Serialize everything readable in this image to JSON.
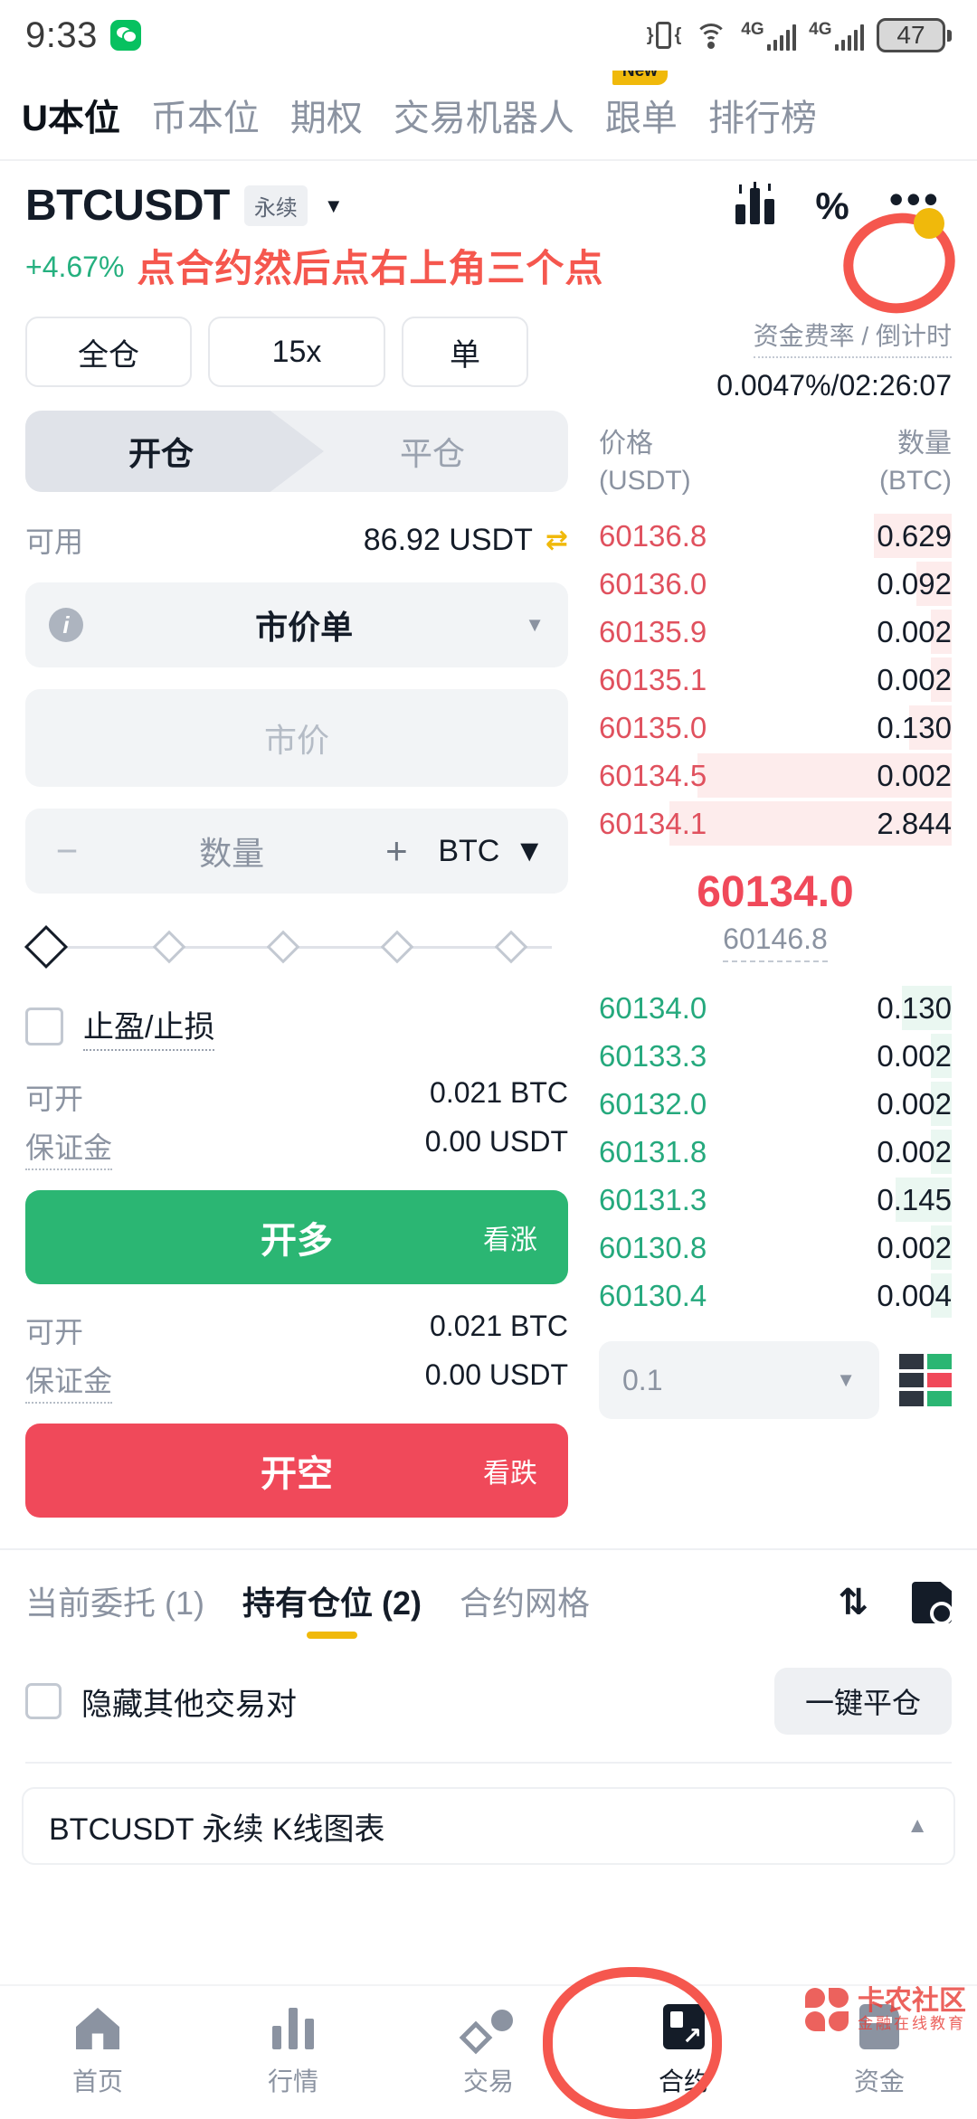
{
  "status_bar": {
    "time": "9:33",
    "wechat_icon": "wechat-icon",
    "icons": [
      "vibrate-icon",
      "wifi-icon",
      "signal-4g-icon",
      "signal-4g-icon",
      "battery-icon"
    ],
    "network_label": "4G",
    "battery_level": "47"
  },
  "top_tabs": [
    {
      "label": "U本位",
      "active": true
    },
    {
      "label": "币本位",
      "active": false
    },
    {
      "label": "期权",
      "active": false
    },
    {
      "label": "交易机器人",
      "active": false
    },
    {
      "label": "跟单",
      "active": false,
      "badge": "New"
    },
    {
      "label": "排行榜",
      "active": false
    }
  ],
  "symbol_header": {
    "symbol": "BTCUSDT",
    "contract_type": "永续",
    "caret": "▼",
    "change_pct": "+4.67%",
    "change_color": "#25b07f",
    "icons": [
      "depth-chart-icon",
      "percent-switch-icon",
      "more-dots-icon"
    ]
  },
  "annotations": {
    "instruction": "点合约然后点右上角三个点",
    "color": "#f5574e"
  },
  "funding": {
    "label": "资金费率 / 倒计时",
    "value": "0.0047%/02:26:07"
  },
  "order_form": {
    "chips": [
      "全仓",
      "15x",
      "单"
    ],
    "segments": [
      {
        "label": "开仓",
        "active": true
      },
      {
        "label": "平仓",
        "active": false
      }
    ],
    "available_label": "可用",
    "available_value": "86.92 USDT",
    "swap_icon": "transfer-icon",
    "order_type": "市价单",
    "order_type_info_icon": "info-icon",
    "price_placeholder": "市价",
    "qty_placeholder": "数量",
    "qty_minus": "−",
    "qty_plus": "+",
    "qty_unit": "BTC",
    "tpsl_label": "止盈/止损",
    "long": {
      "avail_label": "可开",
      "avail_value": "0.021 BTC",
      "margin_label": "保证金",
      "margin_value": "0.00 USDT",
      "button_label": "开多",
      "button_sub": "看涨",
      "button_color": "#2bb673"
    },
    "short": {
      "avail_label": "可开",
      "avail_value": "0.021 BTC",
      "margin_label": "保证金",
      "margin_value": "0.00 USDT",
      "button_label": "开空",
      "button_sub": "看跌",
      "button_color": "#f0495a"
    }
  },
  "order_book": {
    "col_price": "价格",
    "col_price_unit": "(USDT)",
    "col_amount": "数量",
    "col_amount_unit": "(BTC)",
    "asks": [
      {
        "price": "60136.8",
        "amount": "0.629",
        "depth": 22
      },
      {
        "price": "60136.0",
        "amount": "0.092",
        "depth": 10
      },
      {
        "price": "60135.9",
        "amount": "0.002",
        "depth": 6
      },
      {
        "price": "60135.1",
        "amount": "0.002",
        "depth": 6
      },
      {
        "price": "60135.0",
        "amount": "0.130",
        "depth": 12
      },
      {
        "price": "60134.5",
        "amount": "0.002",
        "depth": 72
      },
      {
        "price": "60134.1",
        "amount": "2.844",
        "depth": 80
      }
    ],
    "last_price": "60134.0",
    "mark_price": "60146.8",
    "bids": [
      {
        "price": "60134.0",
        "amount": "0.130",
        "depth": 14
      },
      {
        "price": "60133.3",
        "amount": "0.002",
        "depth": 6
      },
      {
        "price": "60132.0",
        "amount": "0.002",
        "depth": 6
      },
      {
        "price": "60131.8",
        "amount": "0.002",
        "depth": 6
      },
      {
        "price": "60131.3",
        "amount": "0.145",
        "depth": 16
      },
      {
        "price": "60130.8",
        "amount": "0.002",
        "depth": 6
      },
      {
        "price": "60130.4",
        "amount": "0.004",
        "depth": 6
      }
    ],
    "precision": "0.1",
    "depth_toggle_icon": "depth-layout-icon",
    "ask_color": "#e0515e",
    "bid_color": "#25a97d"
  },
  "positions": {
    "tabs": [
      {
        "label": "当前委托 (1)",
        "active": false
      },
      {
        "label": "持有仓位 (2)",
        "active": true
      },
      {
        "label": "合约网格",
        "active": false
      }
    ],
    "tools": [
      "sort-icon",
      "history-icon"
    ],
    "hide_others_label": "隐藏其他交易对",
    "close_all_label": "一键平仓",
    "accent_color": "#f0b90b"
  },
  "kline_bar": {
    "title": "BTCUSDT 永续 K线图表",
    "collapse_icon": "▲"
  },
  "bottom_nav": [
    {
      "label": "首页",
      "icon": "home-icon",
      "active": false
    },
    {
      "label": "行情",
      "icon": "markets-icon",
      "active": false
    },
    {
      "label": "交易",
      "icon": "trade-icon",
      "active": false
    },
    {
      "label": "合约",
      "icon": "contract-icon",
      "active": true
    },
    {
      "label": "资金",
      "icon": "funds-icon",
      "active": false
    }
  ],
  "watermark": {
    "title": "卡农社区",
    "subtitle": "金融在线教育"
  }
}
